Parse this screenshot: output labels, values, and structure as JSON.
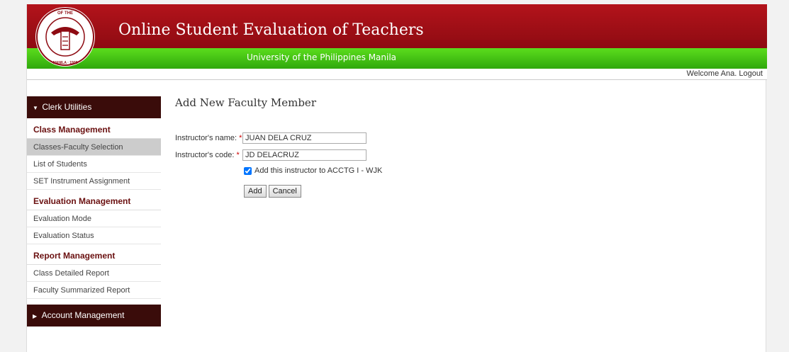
{
  "header": {
    "title": "Online Student Evaluation of Teachers",
    "subtitle": "University of the Philippines Manila",
    "seal_text": "UNIVERSITY OF THE PHILIPPINES MANILA 1908"
  },
  "user_bar": {
    "welcome": "Welcome Ana.",
    "logout": "Logout"
  },
  "sidebar": {
    "clerk_utilities": "Clerk Utilities",
    "class_management": {
      "title": "Class Management",
      "items": [
        "Classes-Faculty Selection",
        "List of Students",
        "SET Instrument Assignment"
      ]
    },
    "evaluation_management": {
      "title": "Evaluation Management",
      "items": [
        "Evaluation Mode",
        "Evaluation Status"
      ]
    },
    "report_management": {
      "title": "Report Management",
      "items": [
        "Class Detailed Report",
        "Faculty Summarized Report"
      ]
    },
    "account_management": "Account Management"
  },
  "form": {
    "heading": "Add New Faculty Member",
    "name_label": "Instructor's name:",
    "name_value": "JUAN DELA CRUZ",
    "code_label": "Instructor's code:",
    "code_value": "JD DELACRUZ",
    "required_mark": "*",
    "checkbox_label": "Add this instructor to ACCTG I - WJK",
    "add_button": "Add",
    "cancel_button": "Cancel"
  },
  "colors": {
    "banner_red": "#a0101a",
    "banner_green": "#3cbf12",
    "sidebar_dark": "#3a0c0a",
    "group_title": "#6a1010",
    "active_item": "#cccccc"
  }
}
